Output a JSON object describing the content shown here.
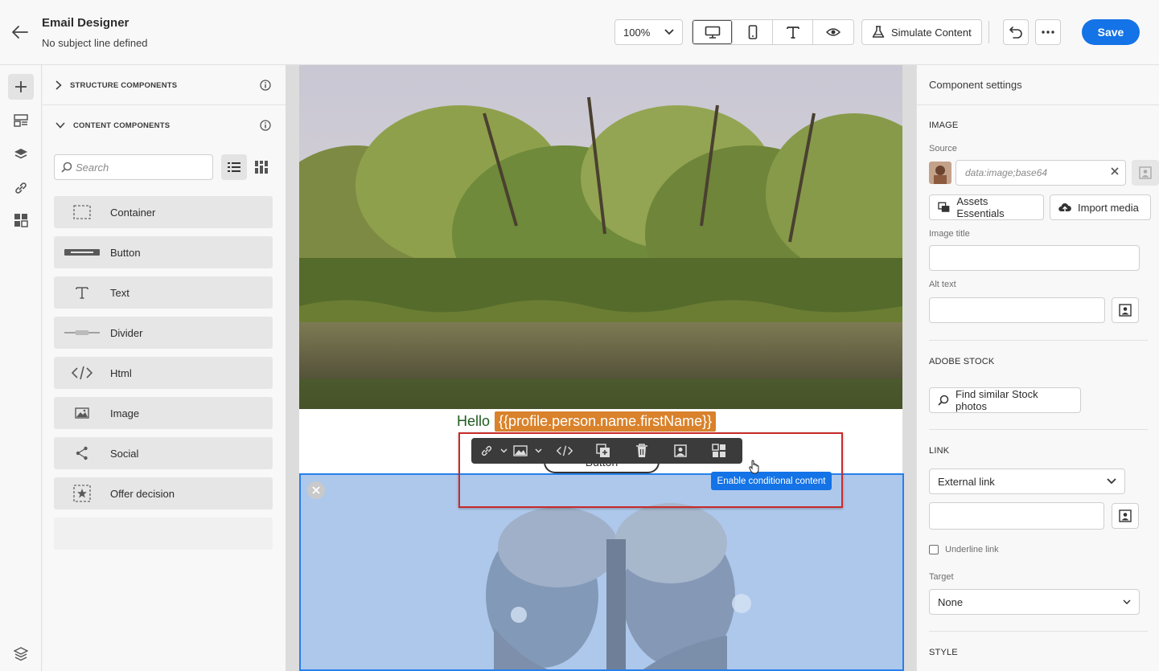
{
  "header": {
    "title": "Email Designer",
    "subtitle": "No subject line defined",
    "zoom": "100%",
    "simulate_label": "Simulate Content",
    "save_label": "Save"
  },
  "left_panel": {
    "structure_label": "STRUCTURE COMPONENTS",
    "content_label": "CONTENT COMPONENTS",
    "search_placeholder": "Search",
    "components": [
      {
        "label": "Container",
        "icon": "container-icon"
      },
      {
        "label": "Button",
        "icon": "button-icon"
      },
      {
        "label": "Text",
        "icon": "text-icon"
      },
      {
        "label": "Divider",
        "icon": "divider-icon"
      },
      {
        "label": "Html",
        "icon": "html-icon"
      },
      {
        "label": "Image",
        "icon": "image-icon"
      },
      {
        "label": "Social",
        "icon": "share-icon"
      },
      {
        "label": "Offer decision",
        "icon": "offer-decision-icon"
      }
    ]
  },
  "canvas": {
    "greeting": "Hello",
    "personalization": "{{profile.person.name.firstName}}",
    "button_text": "Button",
    "tooltip": "Enable conditional content"
  },
  "right_panel": {
    "title": "Component settings",
    "image_section": "IMAGE",
    "source_label": "Source",
    "source_value": "data:image;base64",
    "assets_button": "Assets Essentials",
    "import_button": "Import media",
    "image_title_label": "Image title",
    "alt_text_label": "Alt text",
    "stock_section": "ADOBE STOCK",
    "stock_button": "Find similar Stock photos",
    "link_section": "LINK",
    "link_type": "External link",
    "underline_label": "Underline link",
    "target_label": "Target",
    "target_value": "None",
    "style_section": "STYLE"
  },
  "colors": {
    "accent": "#1473e6",
    "selection_border": "#2680eb",
    "highlight_outline": "#c92a2a",
    "personalization_bg": "#d9822b"
  }
}
